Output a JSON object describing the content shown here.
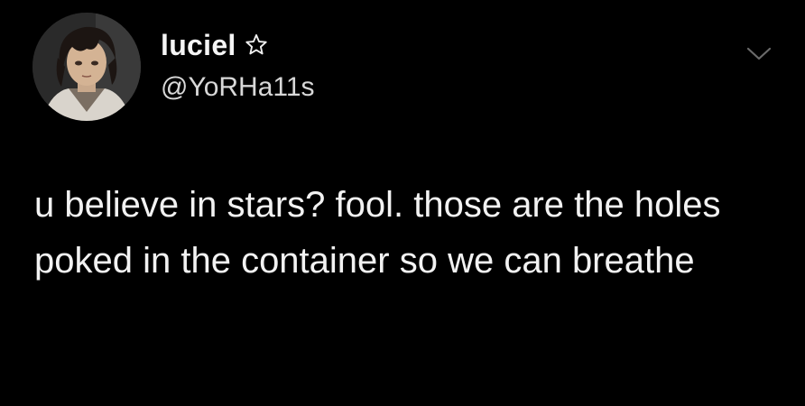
{
  "tweet": {
    "display_name": "luciel",
    "handle": "@YoRHa11s",
    "text": "u believe in stars? fool. those are the holes poked in the container so we can breathe",
    "icons": {
      "avatar": "anime-character-avatar",
      "badge": "star-outline-icon",
      "menu": "chevron-down-icon"
    }
  },
  "colors": {
    "background": "#000000",
    "text": "#f2f2f2",
    "secondary": "#d8d8d8"
  }
}
